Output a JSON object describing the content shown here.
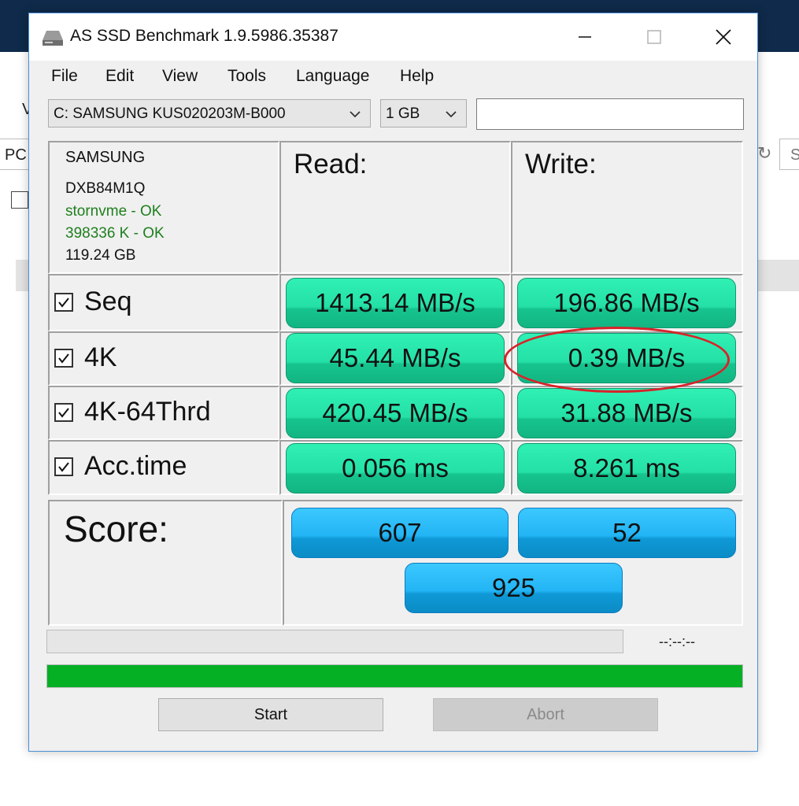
{
  "window": {
    "title": "AS SSD Benchmark 1.9.5986.35387"
  },
  "background_app": {
    "fragment_pc": "PC",
    "fragment_v": "V",
    "fragment_s": "S"
  },
  "menu": [
    "File",
    "Edit",
    "View",
    "Tools",
    "Language",
    "Help"
  ],
  "toolbar": {
    "drive_select": "C: SAMSUNG KUS020203M-B000",
    "size_select": "1 GB",
    "text_value": ""
  },
  "drive_info": {
    "vendor": "SAMSUNG",
    "firmware": "DXB84M1Q",
    "driver_status": "stornvme - OK",
    "alignment_status": "398336 K - OK",
    "capacity": "119.24 GB"
  },
  "columns": {
    "read": "Read:",
    "write": "Write:"
  },
  "rows": [
    {
      "label": "Seq",
      "checked": true,
      "read": "1413.14 MB/s",
      "write": "196.86 MB/s"
    },
    {
      "label": "4K",
      "checked": true,
      "read": "45.44 MB/s",
      "write": "0.39 MB/s"
    },
    {
      "label": "4K-64Thrd",
      "checked": true,
      "read": "420.45 MB/s",
      "write": "31.88 MB/s"
    },
    {
      "label": "Acc.time",
      "checked": true,
      "read": "0.056 ms",
      "write": "8.261 ms"
    }
  ],
  "score": {
    "label": "Score:",
    "read": "607",
    "write": "52",
    "total": "925"
  },
  "status": {
    "elapsed": "--:--:--",
    "progress_fraction": 1.0
  },
  "buttons": {
    "start": "Start",
    "abort": "Abort"
  },
  "colors": {
    "result_green": "#24e0a6",
    "score_blue": "#22b4f4",
    "progress_green": "#06b025",
    "status_ok": "#1e7f1e",
    "annotation_ring": "#d8232a"
  },
  "icons": {
    "app": "drive-icon",
    "minimize": "minimize-icon",
    "maximize": "maximize-icon",
    "close": "close-icon",
    "dropdown": "chevron-down-icon",
    "checkbox": "checkmark-icon"
  }
}
